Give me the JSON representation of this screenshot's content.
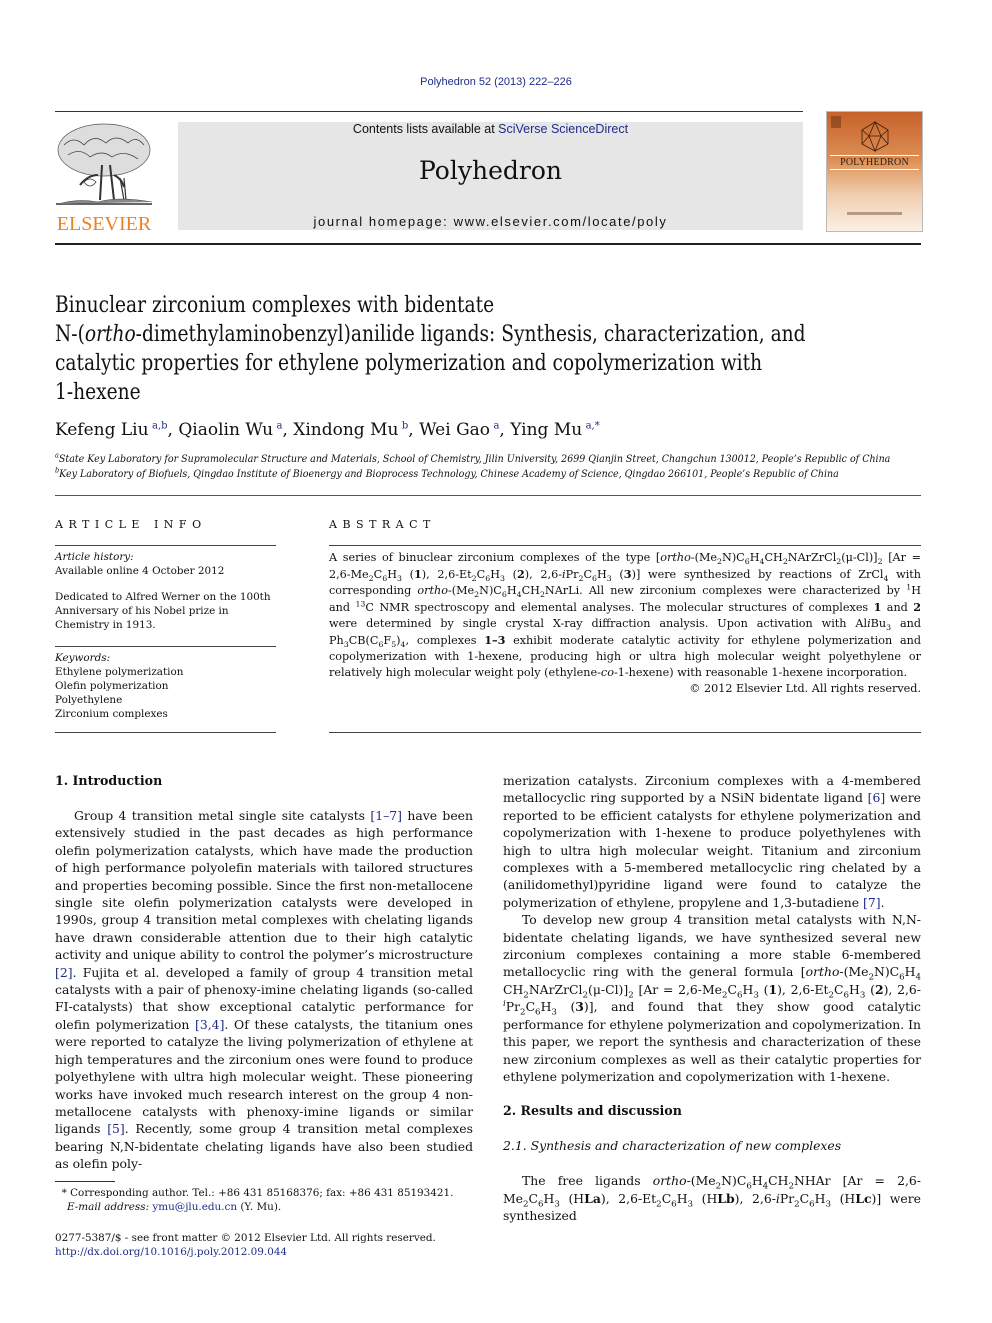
{
  "header": {
    "journal_ref": "Polyhedron 52 (2013) 222–226",
    "publisher_logo_text": "ELSEVIER",
    "contents_prefix": "Contents lists available at ",
    "contents_link": "SciVerse ScienceDirect",
    "journal_title": "Polyhedron",
    "homepage_prefix": "journal homepage: ",
    "homepage_url": "www.elsevier.com/locate/poly",
    "cover_title": "POLYHEDRON",
    "colors": {
      "link": "#1f2d8a",
      "elsevier_orange": "#f07f1e",
      "masthead_bg": "#e6e6e6",
      "cover_orange": "#c6622a"
    }
  },
  "article": {
    "title_lines": [
      "Binuclear zirconium complexes with bidentate",
      [
        "N-(",
        "ortho",
        "-dimethylaminobenzyl)anilide ligands: Synthesis, characterization, and"
      ],
      "catalytic properties for ethylene polymerization and copolymerization with",
      "1-hexene"
    ],
    "authors": [
      {
        "name": "Kefeng Liu",
        "aff": "a,b"
      },
      {
        "name": "Qiaolin Wu",
        "aff": "a"
      },
      {
        "name": "Xindong Mu",
        "aff": "b"
      },
      {
        "name": "Wei Gao",
        "aff": "a"
      },
      {
        "name": "Ying Mu",
        "aff": "a,*"
      }
    ],
    "affiliations": [
      {
        "key": "a",
        "text": "State Key Laboratory for Supramolecular Structure and Materials, School of Chemistry, Jilin University, 2699 Qianjin Street, Changchun 130012, People’s Republic of China"
      },
      {
        "key": "b",
        "text": "Key Laboratory of Biofuels, Qingdao Institute of Bioenergy and Bioprocess Technology, Chinese Academy of Science, Qingdao 266101, People’s Republic of China"
      }
    ]
  },
  "article_info": {
    "heading": "ARTICLE INFO",
    "history_label": "Article history:",
    "history_value": "Available online 4 October 2012",
    "dedication": "Dedicated to Alfred Werner on the 100th Anniversary of his Nobel prize in Chemistry in 1913.",
    "keywords_label": "Keywords:",
    "keywords": [
      "Ethylene polymerization",
      "Olefin polymerization",
      "Polyethylene",
      "Zirconium complexes"
    ]
  },
  "abstract": {
    "heading": "ABSTRACT",
    "copyright": "© 2012 Elsevier Ltd. All rights reserved."
  },
  "sections": {
    "intro_heading": "1. Introduction",
    "results_heading": "2. Results and discussion",
    "subsection_heading": "2.1. Synthesis and characterization of new complexes",
    "citations": [
      "[1–7]",
      "[2]",
      "[3,4]",
      "[5]",
      "[6]",
      "[7]"
    ]
  },
  "footer": {
    "corresponding": "Corresponding author. Tel.: +86 431 85168376; fax: +86 431 85193421.",
    "email_label": "E-mail address:",
    "email": "ymu@jlu.edu.cn",
    "email_suffix": " (Y. Mu).",
    "issn_line": "0277-5387/$ - see front matter © 2012 Elsevier Ltd. All rights reserved.",
    "doi": "http://dx.doi.org/10.1016/j.poly.2012.09.044"
  }
}
